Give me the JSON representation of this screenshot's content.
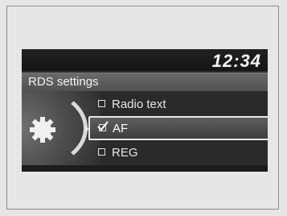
{
  "header": {
    "clock": "12:34"
  },
  "screen": {
    "title": "RDS settings"
  },
  "menu": {
    "items": [
      {
        "label": "Radio text",
        "checked": false,
        "selected": false
      },
      {
        "label": "AF",
        "checked": true,
        "selected": true
      },
      {
        "label": "REG",
        "checked": false,
        "selected": false
      }
    ]
  },
  "icons": {
    "settings": "gear-icon",
    "pointer": "arrow-right-icon"
  },
  "colors": {
    "screen_bg": "#2b2b2b",
    "highlight_border": "#e8e8e8",
    "text": "#e6e6e6"
  }
}
